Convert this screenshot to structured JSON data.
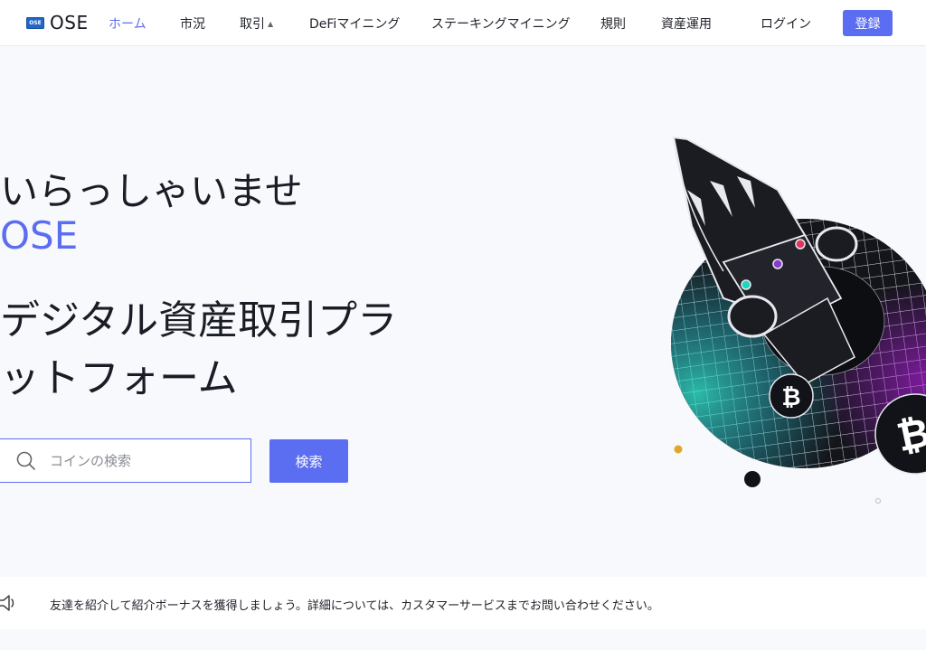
{
  "header": {
    "logo_badge": "OSE",
    "logo_text": "OSE",
    "nav": [
      {
        "label": "ホーム",
        "active": true
      },
      {
        "label": "市況"
      },
      {
        "label": "取引",
        "has_dropdown": true
      },
      {
        "label": "DeFiマイニング"
      },
      {
        "label": "ステーキングマイニング"
      },
      {
        "label": "規則"
      },
      {
        "label": "資産運用"
      }
    ],
    "login_label": "ログイン",
    "register_label": "登録"
  },
  "hero": {
    "welcome": "いらっしゃいませ",
    "brand": "OSE",
    "headline_line1": "デジタル資産取引プラ",
    "headline_line2": "ットフォーム",
    "search_placeholder": "コインの検索",
    "search_button": "検索"
  },
  "notice": {
    "text": "友達を紹介して紹介ボーナスを獲得しましょう。詳細については、カスタマーサービスまでお問い合わせください。"
  },
  "colors": {
    "accent": "#5b6df0",
    "background": "#f8f9fc"
  }
}
